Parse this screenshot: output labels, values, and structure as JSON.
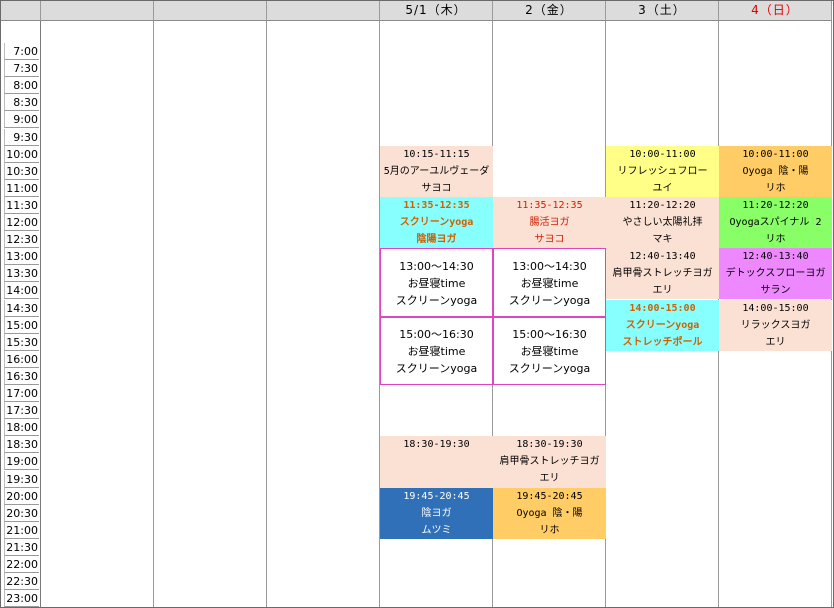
{
  "headers": [
    {
      "label": "",
      "color": "#000000"
    },
    {
      "label": "",
      "color": "#000000"
    },
    {
      "label": "",
      "color": "#000000"
    },
    {
      "label": "5/1（木）",
      "color": "#000000"
    },
    {
      "label": "2（金）",
      "color": "#000000"
    },
    {
      "label": "3（土）",
      "color": "#000000"
    },
    {
      "label": "4（日）",
      "color": "#e00000"
    }
  ],
  "times": [
    "7:00",
    "7:30",
    "8:00",
    "8:30",
    "9:00",
    "9:30",
    "10:00",
    "10:30",
    "11:00",
    "11:30",
    "12:00",
    "12:30",
    "13:00",
    "13:30",
    "14:00",
    "14:30",
    "15:00",
    "15:30",
    "16:00",
    "16:30",
    "17:00",
    "17:30",
    "18:00",
    "18:30",
    "19:00",
    "19:30",
    "20:00",
    "20:30",
    "21:00",
    "21:30",
    "22:00",
    "22:30",
    "23:00"
  ],
  "events": [
    {
      "col": 3,
      "row": 6,
      "rows": 3,
      "bg": "#fbe0d4",
      "fg": "#000000",
      "style": "mono",
      "lines": [
        "10:15-11:15",
        "5月のアーユルヴェーダ",
        "サヨコ"
      ]
    },
    {
      "col": 3,
      "row": 9,
      "rows": 3,
      "bg": "#88ffff",
      "fg": "#d06000",
      "style": "mono bold",
      "lines": [
        "11:35-12:35",
        "スクリーンyoga",
        "陰陽ヨガ"
      ]
    },
    {
      "col": 4,
      "row": 9,
      "rows": 3,
      "bg": "#fbe0d4",
      "fg": "#d02000",
      "style": "mono",
      "lines": [
        "11:35-12:35",
        "腸活ヨガ",
        "サヨコ"
      ]
    },
    {
      "col": 3,
      "row": 12,
      "rows": 4,
      "bg": "#ffffff",
      "fg": "#000000",
      "style": "boxed",
      "lines": [
        "13:00～14:30",
        "お昼寝time",
        "スクリーンyoga"
      ]
    },
    {
      "col": 4,
      "row": 12,
      "rows": 4,
      "bg": "#ffffff",
      "fg": "#000000",
      "style": "boxed",
      "lines": [
        "13:00～14:30",
        "お昼寝time",
        "スクリーンyoga"
      ]
    },
    {
      "col": 3,
      "row": 16,
      "rows": 4,
      "bg": "#ffffff",
      "fg": "#000000",
      "style": "boxed",
      "lines": [
        "15:00～16:30",
        "お昼寝time",
        "スクリーンyoga"
      ]
    },
    {
      "col": 4,
      "row": 16,
      "rows": 4,
      "bg": "#ffffff",
      "fg": "#000000",
      "style": "boxed",
      "lines": [
        "15:00～16:30",
        "お昼寝time",
        "スクリーンyoga"
      ]
    },
    {
      "col": 5,
      "row": 6,
      "rows": 3,
      "bg": "#ffff88",
      "fg": "#000000",
      "style": "mono",
      "lines": [
        "10:00-11:00",
        "リフレッシュフロー",
        "ユイ"
      ]
    },
    {
      "col": 5,
      "row": 9,
      "rows": 3,
      "bg": "#fbe0d4",
      "fg": "#000000",
      "style": "mono",
      "lines": [
        "11:20-12:20",
        "やさしい太陽礼拝",
        "マキ"
      ]
    },
    {
      "col": 5,
      "row": 12,
      "rows": 3,
      "bg": "#fbe0d4",
      "fg": "#000000",
      "style": "mono",
      "lines": [
        "12:40-13:40",
        "肩甲骨ストレッチヨガ",
        "エリ"
      ]
    },
    {
      "col": 5,
      "row": 15,
      "rows": 3,
      "bg": "#88ffff",
      "fg": "#d06000",
      "style": "mono bold",
      "lines": [
        "14:00-15:00",
        "スクリーンyoga",
        "ストレッチポール"
      ]
    },
    {
      "col": 6,
      "row": 6,
      "rows": 3,
      "bg": "#ffcc66",
      "fg": "#000000",
      "style": "mono",
      "lines": [
        "10:00-11:00",
        "Oyoga 陰・陽",
        "リホ"
      ]
    },
    {
      "col": 6,
      "row": 9,
      "rows": 3,
      "bg": "#88ff66",
      "fg": "#000000",
      "style": "mono",
      "lines": [
        "11:20-12:20",
        "Oyogaスパイナル 2",
        "リホ"
      ]
    },
    {
      "col": 6,
      "row": 12,
      "rows": 3,
      "bg": "#ee88ff",
      "fg": "#000000",
      "style": "mono",
      "lines": [
        "12:40-13:40",
        "デトックスフローヨガ",
        "サラン"
      ]
    },
    {
      "col": 6,
      "row": 15,
      "rows": 3,
      "bg": "#fbe0d4",
      "fg": "#000000",
      "style": "mono",
      "lines": [
        "14:00-15:00",
        "リラックスヨガ",
        "エリ"
      ]
    },
    {
      "col": 3,
      "row": 23,
      "rows": 3,
      "bg": "#fbe0d4",
      "fg": "#000000",
      "style": "mono",
      "lines": [
        "18:30-19:30",
        "",
        ""
      ]
    },
    {
      "col": 4,
      "row": 23,
      "rows": 3,
      "bg": "#fbe0d4",
      "fg": "#000000",
      "style": "mono",
      "lines": [
        "18:30-19:30",
        "肩甲骨ストレッチヨガ",
        "エリ"
      ]
    },
    {
      "col": 3,
      "row": 26,
      "rows": 3,
      "bg": "#3070b8",
      "fg": "#ffffff",
      "style": "mono",
      "lines": [
        "19:45-20:45",
        "陰ヨガ",
        "ムツミ"
      ]
    },
    {
      "col": 4,
      "row": 26,
      "rows": 3,
      "bg": "#ffcc66",
      "fg": "#000000",
      "style": "mono",
      "lines": [
        "19:45-20:45",
        "Oyoga 陰・陽",
        "リホ"
      ]
    }
  ]
}
